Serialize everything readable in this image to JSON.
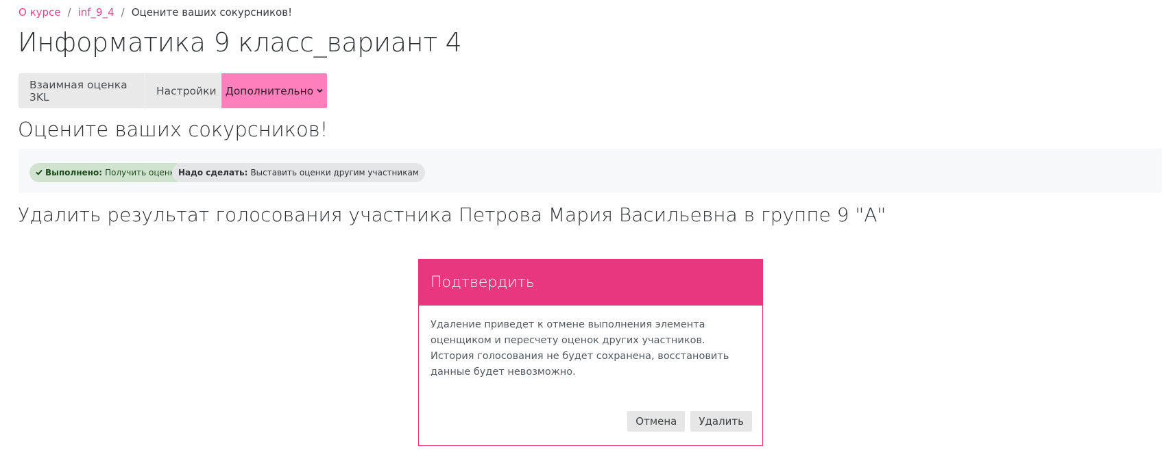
{
  "breadcrumb": {
    "items": [
      "О курсе",
      "inf_9_4"
    ],
    "separator": "/",
    "current": "Оцените ваших сокурсников!"
  },
  "page_title": "Информатика 9 класс_вариант 4",
  "tabs": [
    {
      "label": "Взаимная оценка 3KL"
    },
    {
      "label": "Настройки"
    },
    {
      "label": "Дополнительно",
      "icon": "chevron-down-icon"
    }
  ],
  "activity_title": "Оцените ваших сокурсников!",
  "completion": {
    "done": {
      "label": "Выполнено:",
      "text": "Получить оценку",
      "icon": "check-icon"
    },
    "todo": {
      "label": "Надо сделать:",
      "text": "Выставить оценки другим участникам"
    }
  },
  "delete_heading": "Удалить результат голосования участника Петрова Мария Васильевна в группе 9 \"А\"",
  "modal": {
    "title": "Подтвердить",
    "body_line1": "Удаление приведет к отмене выполнения элемента оценщиком и пересчету оценок других участников.",
    "body_line2": "История голосования не будет сохранена, восстановить данные будет невозможно.",
    "cancel_label": "Отмена",
    "delete_label": "Удалить"
  },
  "colors": {
    "accent": "#e8367f",
    "active_tab": "#fd7fbc",
    "link": "#e8448e"
  }
}
